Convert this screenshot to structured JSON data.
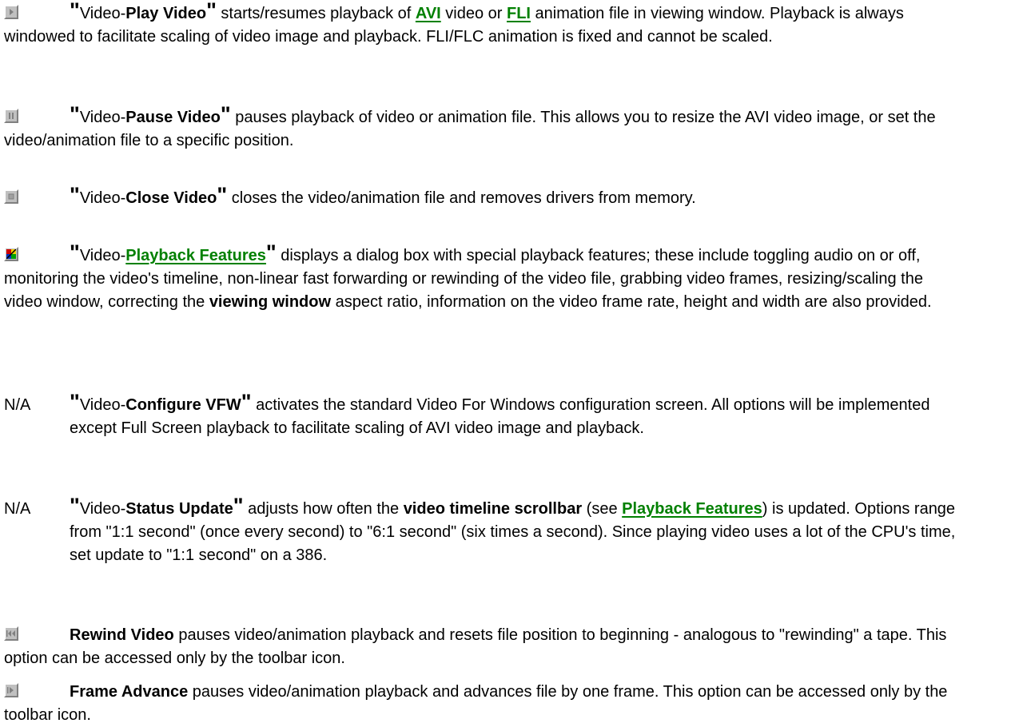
{
  "entries": [
    {
      "id": "play",
      "icon": "play-icon",
      "quote_open": "\"",
      "menu": "Video-",
      "command": "Play Video",
      "quote_close": "\"",
      "t1": " starts/resumes playback of ",
      "link1": "AVI",
      "t2": " video or ",
      "link2": "FLI",
      "t3": " animation file in viewing window.   Playback is always windowed to facilitate scaling of video image and playback.   FLI/FLC animation is fixed and cannot be scaled."
    },
    {
      "id": "pause",
      "icon": "pause-icon",
      "quote_open": "\"",
      "menu": "Video-",
      "command": "Pause Video",
      "quote_close": "\"",
      "t1": " pauses playback of video or animation file.   This allows you to resize the AVI video image, or set the video/animation file to a specific position."
    },
    {
      "id": "close",
      "icon": "stop-icon",
      "quote_open": "\"",
      "menu": "Video-",
      "command": "Close Video",
      "quote_close": "\"",
      "t1": " closes the video/animation file and removes drivers from memory."
    },
    {
      "id": "features",
      "icon": "playback-features-icon",
      "quote_open": "\"",
      "menu": "Video-",
      "link1": "Playback Features",
      "quote_close": "\"",
      "t1": " displays a dialog box with special playback features; these include toggling audio on or off, monitoring the video's timeline, non-linear fast forwarding or rewinding of the video file, grabbing video frames, resizing/scaling the video window, correcting the ",
      "bold1": "viewing window",
      "t2": " aspect ratio,   information on the video frame rate, height and width are also provided."
    },
    {
      "id": "configure",
      "marker": "N/A",
      "quote_open": "\"",
      "menu": "Video-",
      "command": "Configure VFW",
      "quote_close": "\"",
      "t1": " activates the standard Video For Windows configuration screen.   All options will be implemented except Full Screen playback to facilitate scaling of AVI video image and playback."
    },
    {
      "id": "status",
      "marker": "N/A",
      "quote_open": "\"",
      "menu": "Video-",
      "command": "Status Update",
      "quote_close": "\"",
      "t1": " adjusts how often the ",
      "bold1": "video timeline scrollbar",
      "t2": " (see ",
      "link1": "Playback Features",
      "t3": ") is updated.   Options range from \"1:1 second\" (once every second) to \"6:1 second\" (six times a second).   Since playing video uses a lot of the CPU's time, set update to \"1:1 second\" on a 386."
    },
    {
      "id": "rewind",
      "icon": "rewind-icon",
      "command": "Rewind Video",
      "t1": " pauses video/animation playback and resets file position to beginning - analogous to \"rewinding\" a tape.   This option can be accessed only by the toolbar icon."
    },
    {
      "id": "advance",
      "icon": "frame-advance-icon",
      "command": "Frame Advance",
      "t1": " pauses video/animation playback and advances file by one frame.   This option can be accessed only by the toolbar icon."
    }
  ]
}
